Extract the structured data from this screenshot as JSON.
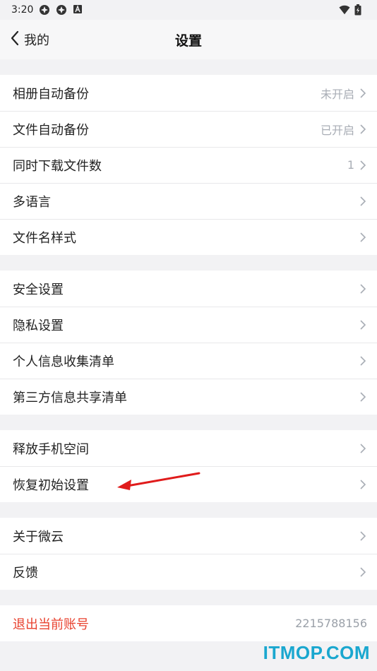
{
  "status": {
    "time": "3:20"
  },
  "nav": {
    "back_label": "我的",
    "title": "设置"
  },
  "sections": [
    [
      {
        "label": "相册自动备份",
        "value": "未开启"
      },
      {
        "label": "文件自动备份",
        "value": "已开启"
      },
      {
        "label": "同时下载文件数",
        "value": "1"
      },
      {
        "label": "多语言",
        "value": ""
      },
      {
        "label": "文件名样式",
        "value": ""
      }
    ],
    [
      {
        "label": "安全设置",
        "value": ""
      },
      {
        "label": "隐私设置",
        "value": ""
      },
      {
        "label": "个人信息收集清单",
        "value": ""
      },
      {
        "label": "第三方信息共享清单",
        "value": ""
      }
    ],
    [
      {
        "label": "释放手机空间",
        "value": ""
      },
      {
        "label": "恢复初始设置",
        "value": ""
      }
    ],
    [
      {
        "label": "关于微云",
        "value": ""
      },
      {
        "label": "反馈",
        "value": ""
      }
    ]
  ],
  "logout": {
    "label": "退出当前账号",
    "account": "2215788156"
  },
  "watermark": "ITMOP.COM",
  "colors": {
    "accent_red": "#e8412e",
    "watermark_blue": "#1aa7cf"
  }
}
